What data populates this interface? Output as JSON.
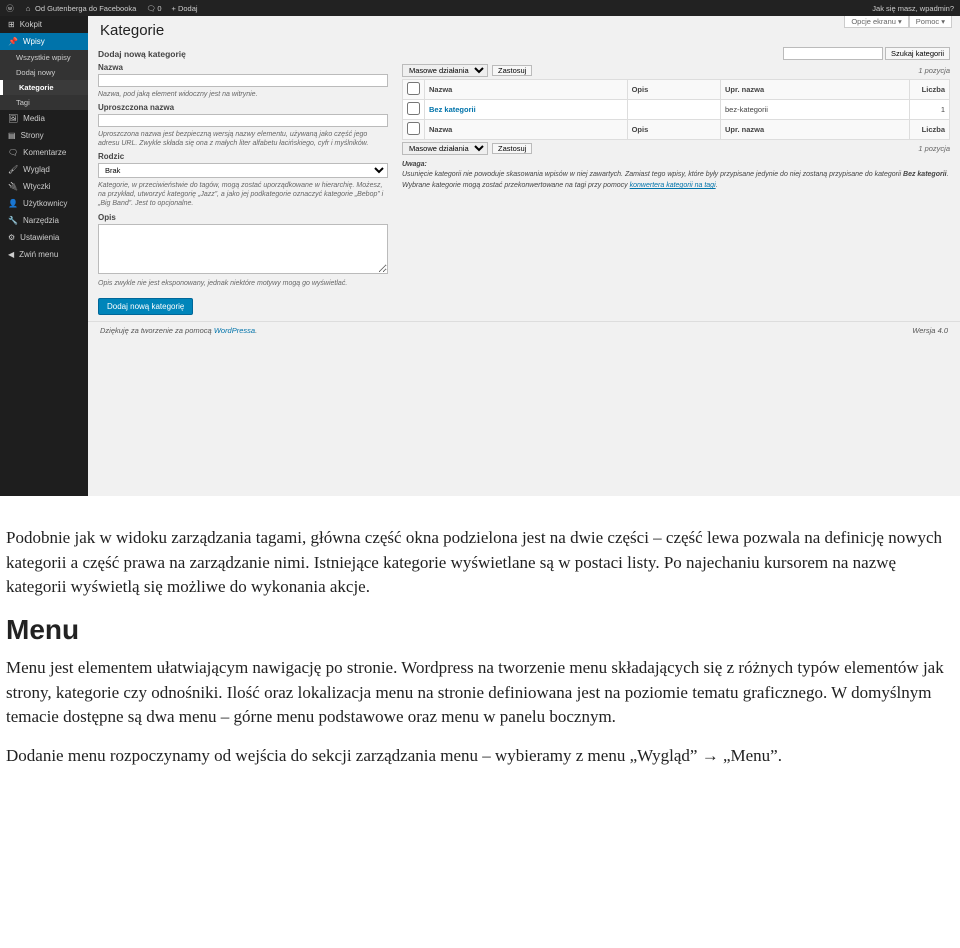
{
  "topbar": {
    "site": "Od Gutenberga do Facebooka",
    "comments": "0",
    "add": "+ Dodaj",
    "greeting": "Jak się masz, wpadmin?"
  },
  "screen_tabs": {
    "options": "Opcje ekranu",
    "help": "Pomoc"
  },
  "sidebar": {
    "kokpit": "Kokpit",
    "wpisy": "Wpisy",
    "subs": [
      "Wszystkie wpisy",
      "Dodaj nowy",
      "Kategorie",
      "Tagi"
    ],
    "media": "Media",
    "strony": "Strony",
    "komentarze": "Komentarze",
    "wyglad": "Wygląd",
    "wtyczki": "Wtyczki",
    "uzytkownicy": "Użytkownicy",
    "narzedzia": "Narzędzia",
    "ustawienia": "Ustawienia",
    "zwin": "Zwiń menu"
  },
  "page_title": "Kategorie",
  "form": {
    "heading": "Dodaj nową kategorię",
    "name_label": "Nazwa",
    "name_hint": "Nazwa, pod jaką element widoczny jest na witrynie.",
    "slug_label": "Uproszczona nazwa",
    "slug_hint": "Uproszczona nazwa jest bezpieczną wersją nazwy elementu, używaną jako część jego adresu URL. Zwykle składa się ona z małych liter alfabetu łacińskiego, cyfr i myślników.",
    "parent_label": "Rodzic",
    "parent_option": "Brak",
    "parent_hint": "Kategorie, w przeciwieństwie do tagów, mogą zostać uporządkowane w hierarchię. Możesz, na przykład, utworzyć kategorię „Jazz”, a jako jej podkategorie oznaczyć kategorie „Bebop” i „Big Band”. Jest to opcjonalne.",
    "desc_label": "Opis",
    "desc_hint": "Opis zwykle nie jest eksponowany, jednak niektóre motywy mogą go wyświetlać.",
    "submit": "Dodaj nową kategorię"
  },
  "list": {
    "search_btn": "Szukaj kategorii",
    "bulk_label": "Masowe działania",
    "apply": "Zastosuj",
    "count_text": "1 pozycja",
    "col_name": "Nazwa",
    "col_desc": "Opis",
    "col_slug": "Upr. nazwa",
    "col_count": "Liczba",
    "row_name": "Bez kategorii",
    "row_slug": "bez-kategorii",
    "row_count": "1"
  },
  "notes": {
    "h": "Uwaga:",
    "p1a": "Usunięcie kategorii nie powoduje skasowania wpisów w niej zawartych. Zamiast tego wpisy, które były przypisane jedynie do niej zostaną przypisane do kategorii ",
    "p1b": "Bez kategorii",
    "p2a": "Wybrane kategorie mogą zostać przekonwertowane na tagi przy pomocy ",
    "p2link": "konwertera kategorii na tagi",
    "p2b": "."
  },
  "footer": {
    "thanks_a": "Dziękuję za tworzenie za pomocą ",
    "thanks_link": "WordPressa",
    "thanks_b": ".",
    "version": "Wersja 4.0"
  },
  "doc": {
    "p1": "Podobnie jak w widoku zarządzania tagami, główna część okna podzielona jest na dwie części – część lewa pozwala na definicję nowych kategorii a część prawa na zarządzanie nimi. Istniejące kategorie wyświetlane są w postaci listy. Po najechaniu kursorem na nazwę kategorii wyświetlą się możliwe do wykonania akcje.",
    "h2": "Menu",
    "p2": "Menu jest elementem ułatwiającym nawigację po stronie. Wordpress na tworzenie menu składających się z różnych typów elementów jak strony, kategorie czy odnośniki. Ilość oraz lokalizacja menu na stronie definiowana jest na poziomie tematu graficznego. W domyślnym temacie dostępne są dwa menu – górne menu podstawowe oraz menu w panelu bocznym.",
    "p3": "Dodanie menu rozpoczynamy od wejścia do sekcji zarządzania menu – wybieramy z menu „Wygląd” → „Menu”."
  }
}
